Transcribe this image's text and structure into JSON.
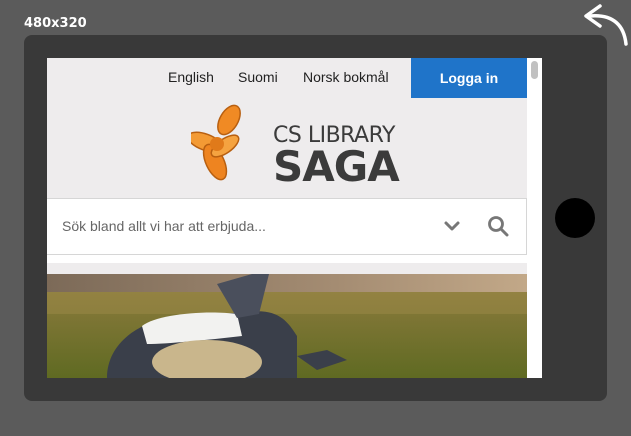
{
  "viewport_label": "480x320",
  "icons": {
    "rotate": "rotate-arrow-icon",
    "search": "search-icon",
    "chevron": "chevron-down-icon"
  },
  "colors": {
    "login_bg": "#1f74c9",
    "logo_orange": "#f08a24"
  },
  "site": {
    "languages": [
      "English",
      "Suomi",
      "Norsk bokmål"
    ],
    "login_label": "Logga in",
    "logo_top": "CS LIBRARY",
    "logo_bottom": "SAGA",
    "search_placeholder": "Sök bland allt vi har att erbjuda..."
  }
}
